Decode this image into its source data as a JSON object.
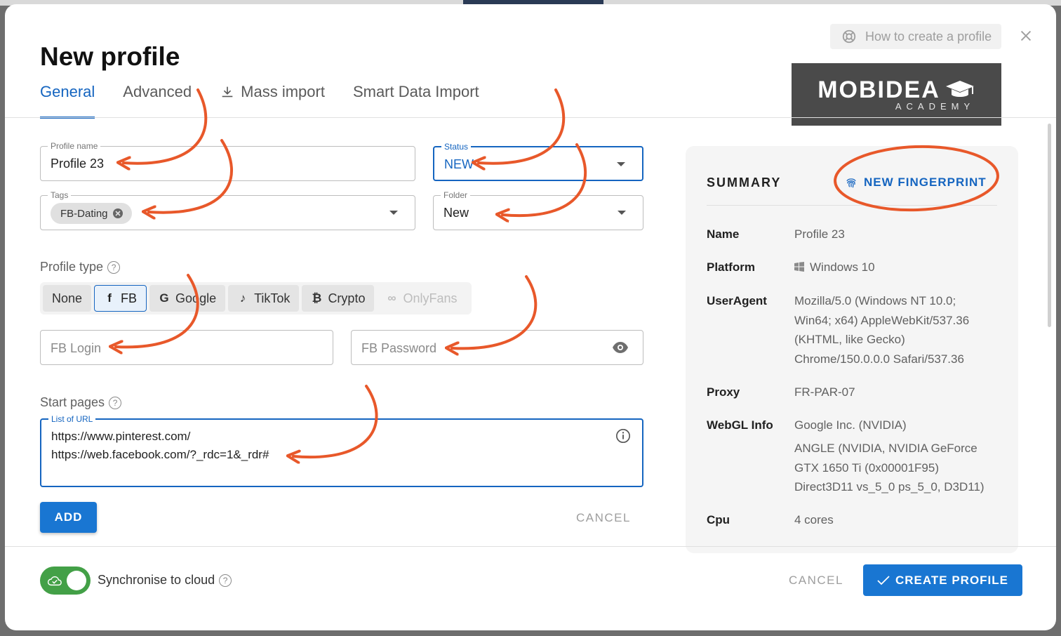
{
  "dialog": {
    "title": "New profile",
    "help_label": "How to create a profile"
  },
  "tabs": [
    {
      "label": "General",
      "active": true
    },
    {
      "label": "Advanced"
    },
    {
      "label": "Mass import",
      "icon": "download-icon"
    },
    {
      "label": "Smart Data Import"
    }
  ],
  "logo": {
    "brand": "MOBIDEA",
    "sub": "ACADEMY"
  },
  "form": {
    "profile_name": {
      "label": "Profile name",
      "value": "Profile 23"
    },
    "status": {
      "label": "Status",
      "value": "NEW"
    },
    "tags": {
      "label": "Tags",
      "chip": "FB-Dating"
    },
    "folder": {
      "label": "Folder",
      "value": "New"
    },
    "profile_type": {
      "label": "Profile type",
      "options": [
        {
          "label": "None",
          "icon": ""
        },
        {
          "label": "FB",
          "icon": "f",
          "selected": true
        },
        {
          "label": "Google",
          "icon": "G"
        },
        {
          "label": "TikTok",
          "icon": "♪"
        },
        {
          "label": "Crypto",
          "icon": "₿"
        },
        {
          "label": "OnlyFans",
          "icon": "∞",
          "disabled": true
        }
      ]
    },
    "fb_login": {
      "placeholder": "FB Login"
    },
    "fb_password": {
      "placeholder": "FB Password"
    },
    "start_pages": {
      "label": "Start pages",
      "field_label": "List of URL",
      "urls": [
        "https://www.pinterest.com/",
        "https://web.facebook.com/?_rdc=1&_rdr#"
      ]
    },
    "add_label": "ADD",
    "cancel_label": "CANCEL"
  },
  "summary": {
    "title": "SUMMARY",
    "new_fingerprint": "NEW FINGERPRINT",
    "rows": {
      "name": {
        "label": "Name",
        "value": "Profile 23"
      },
      "platform": {
        "label": "Platform",
        "value": "Windows 10"
      },
      "useragent": {
        "label": "UserAgent",
        "line1": "Mozilla/5.0 (Windows NT 10.0;",
        "line2": "Win64; x64) AppleWebKit/537.36",
        "line3": "(KHTML, like Gecko)",
        "line4": "Chrome/150.0.0.0 Safari/537.36"
      },
      "proxy": {
        "label": "Proxy",
        "value": "FR-PAR-07"
      },
      "webgl": {
        "label": "WebGL Info",
        "vendor": "Google Inc. (NVIDIA)",
        "line1": "ANGLE (NVIDIA, NVIDIA GeForce",
        "line2": "GTX 1650 Ti (0x00001F95)",
        "line3": "Direct3D11 vs_5_0 ps_5_0, D3D11)"
      },
      "cpu": {
        "label": "Cpu",
        "value": "4 cores"
      }
    }
  },
  "footer": {
    "sync_label": "Synchronise to cloud",
    "sync_on": true,
    "cancel_label": "CANCEL",
    "create_label": "CREATE PROFILE"
  },
  "colors": {
    "accent": "#1976d2",
    "annotation": "#e8582a",
    "toggle": "#43a047"
  }
}
